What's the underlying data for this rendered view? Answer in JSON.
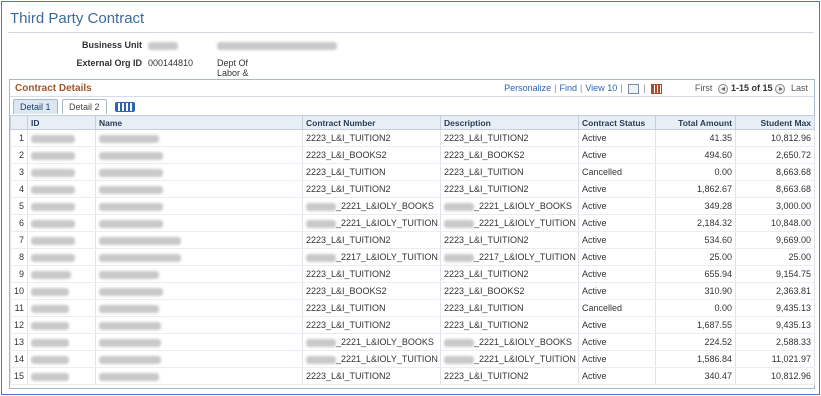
{
  "page": {
    "title": "Third Party Contract"
  },
  "header": {
    "business_unit_label": "Business Unit",
    "external_org_label": "External Org ID",
    "external_org_id": "000144810",
    "external_org_name": "Dept Of Labor & Industries-Wa"
  },
  "grid": {
    "caption": "Contract Details",
    "nav": {
      "personalize": "Personalize",
      "find": "Find",
      "view": "View 10",
      "first": "First",
      "range": "1-15 of 15",
      "last": "Last"
    },
    "tabs": [
      "Detail 1",
      "Detail 2"
    ],
    "columns": [
      "ID",
      "Name",
      "Contract Number",
      "Description",
      "Contract Status",
      "Total Amount",
      "Student Max"
    ],
    "rows": [
      {
        "n": "1",
        "contract": "2223_L&I_TUITION2",
        "desc": "2223_L&I_TUITION2",
        "status": "Active",
        "amount": "41.35",
        "max": "10,812.96"
      },
      {
        "n": "2",
        "contract": "2223_L&I_BOOKS2",
        "desc": "2223_L&I_BOOKS2",
        "status": "Active",
        "amount": "494.60",
        "max": "2,650.72"
      },
      {
        "n": "3",
        "contract": "2223_L&I_TUITION",
        "desc": "2223_L&I_TUITION",
        "status": "Cancelled",
        "amount": "0.00",
        "max": "8,663.68"
      },
      {
        "n": "4",
        "contract": "2223_L&I_TUITION2",
        "desc": "2223_L&I_TUITION2",
        "status": "Active",
        "amount": "1,862.67",
        "max": "8,663.68"
      },
      {
        "n": "5",
        "contract": "_2221_L&IOLY_BOOKS",
        "desc": "_2221_L&IOLY_BOOKS",
        "status": "Active",
        "amount": "349.28",
        "max": "3,000.00"
      },
      {
        "n": "6",
        "contract": "_2221_L&IOLY_TUITION",
        "desc": "_2221_L&IOLY_TUITION",
        "status": "Active",
        "amount": "2,184.32",
        "max": "10,848.00"
      },
      {
        "n": "7",
        "contract": "2223_L&I_TUITION2",
        "desc": "2223_L&I_TUITION2",
        "status": "Active",
        "amount": "534.60",
        "max": "9,669.00"
      },
      {
        "n": "8",
        "contract": "_2217_L&IOLY_TUITION",
        "desc": "_2217_L&IOLY_TUITION",
        "status": "Active",
        "amount": "25.00",
        "max": "25.00"
      },
      {
        "n": "9",
        "contract": "2223_L&I_TUITION2",
        "desc": "2223_L&I_TUITION2",
        "status": "Active",
        "amount": "655.94",
        "max": "9,154.75"
      },
      {
        "n": "10",
        "contract": "2223_L&I_BOOKS2",
        "desc": "2223_L&I_BOOKS2",
        "status": "Active",
        "amount": "310.90",
        "max": "2,363.81"
      },
      {
        "n": "11",
        "contract": "2223_L&I_TUITION",
        "desc": "2223_L&I_TUITION",
        "status": "Cancelled",
        "amount": "0.00",
        "max": "9,435.13"
      },
      {
        "n": "12",
        "contract": "2223_L&I_TUITION2",
        "desc": "2223_L&I_TUITION2",
        "status": "Active",
        "amount": "1,687.55",
        "max": "9,435.13"
      },
      {
        "n": "13",
        "contract": "_2221_L&IOLY_BOOKS",
        "desc": "_2221_L&IOLY_BOOKS",
        "status": "Active",
        "amount": "224.52",
        "max": "2,588.33"
      },
      {
        "n": "14",
        "contract": "_2221_L&IOLY_TUITION",
        "desc": "_2221_L&IOLY_TUITION",
        "status": "Active",
        "amount": "1,586.84",
        "max": "11,021.97"
      },
      {
        "n": "15",
        "contract": "2223_L&I_TUITION2",
        "desc": "2223_L&I_TUITION2",
        "status": "Active",
        "amount": "340.47",
        "max": "10,812.96"
      }
    ]
  }
}
